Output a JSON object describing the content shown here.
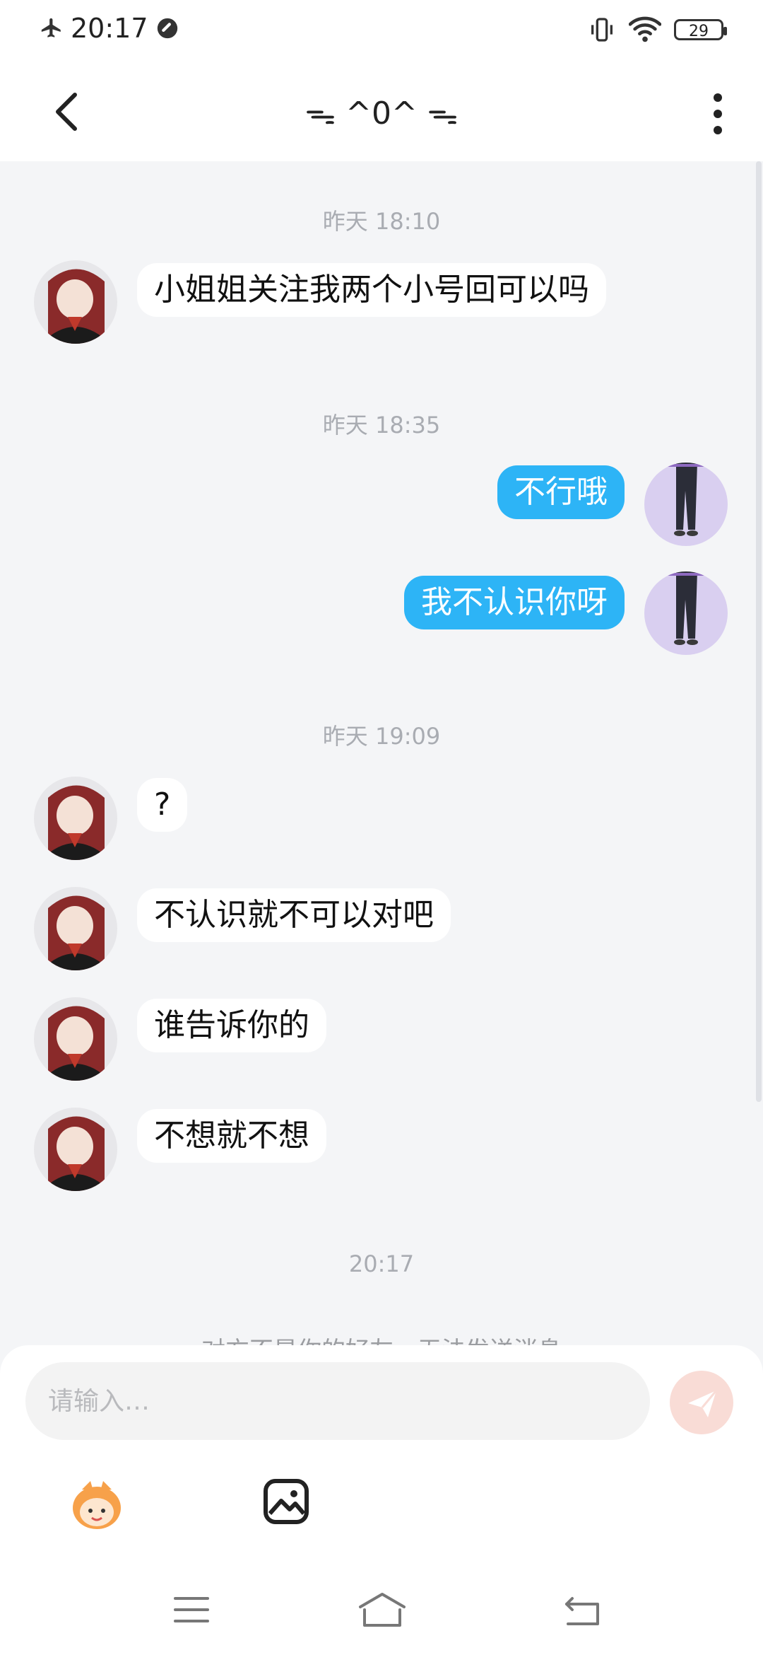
{
  "status_bar": {
    "time": "20:17",
    "battery": "29"
  },
  "header": {
    "title": "ᯓ ^0^ ᯓ"
  },
  "messages": [
    {
      "type": "timestamp",
      "text": "昨天 18:10"
    },
    {
      "type": "incoming",
      "text": "小姐姐关注我两个小号回可以吗"
    },
    {
      "type": "timestamp",
      "text": "昨天 18:35"
    },
    {
      "type": "outgoing",
      "text": "不行哦"
    },
    {
      "type": "outgoing",
      "text": "我不认识你呀"
    },
    {
      "type": "timestamp",
      "text": "昨天 19:09"
    },
    {
      "type": "incoming",
      "text": "?"
    },
    {
      "type": "incoming",
      "text": "不认识就不可以对吧"
    },
    {
      "type": "incoming",
      "text": "谁告诉你的"
    },
    {
      "type": "incoming",
      "text": "不想就不想"
    },
    {
      "type": "timestamp",
      "text": "20:17"
    }
  ],
  "notice": "对方不是你的好友，无法发送消息",
  "composer": {
    "placeholder": "请输入…"
  },
  "colors": {
    "accent": "#2db4f6",
    "background": "#f4f5f7"
  },
  "icons": [
    "airplane-icon",
    "dnd-icon",
    "vibrate-icon",
    "wifi-icon",
    "battery-icon",
    "back-icon",
    "more-icon",
    "send-icon",
    "emoji-mascot-icon",
    "image-icon",
    "menu-icon",
    "home-icon",
    "return-icon"
  ]
}
